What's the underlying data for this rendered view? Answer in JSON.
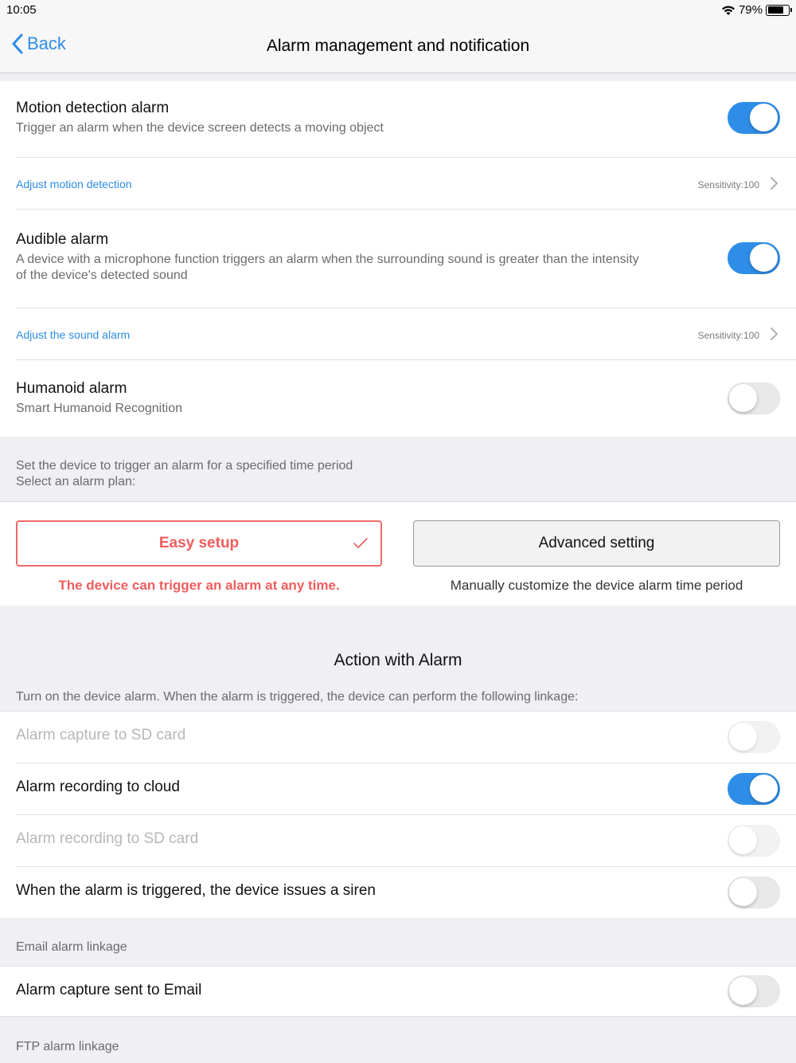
{
  "status": {
    "time": "10:05",
    "battery": "79%"
  },
  "nav": {
    "back_label": "Back",
    "title": "Alarm management and notification"
  },
  "motion": {
    "title": "Motion detection alarm",
    "subtitle": "Trigger an alarm when the device screen detects a moving object",
    "enabled": true,
    "adjust_label": "Adjust motion detection",
    "sensitivity": "Sensitivity:100"
  },
  "audible": {
    "title": "Audible alarm",
    "subtitle_line1": "A device with a microphone function triggers an alarm when the surrounding sound is greater than the intensity",
    "subtitle_line2": "of the device's detected sound",
    "enabled": true,
    "adjust_label": "Adjust the sound alarm",
    "sensitivity": "Sensitivity:100"
  },
  "humanoid": {
    "title": "Humanoid alarm",
    "subtitle": "Smart Humanoid Recognition",
    "enabled": false
  },
  "plan": {
    "hint_line1": "Set the device to trigger an alarm for a specified time period",
    "hint_line2": "Select an alarm plan:",
    "easy_label": "Easy setup",
    "easy_desc": "The device can trigger an alarm at any time.",
    "advanced_label": "Advanced setting",
    "advanced_desc": "Manually customize the device alarm time period",
    "selected": "easy"
  },
  "action": {
    "header": "Action with Alarm",
    "hint": "Turn on the device alarm. When the alarm is triggered, the device can perform the following linkage:",
    "items": [
      {
        "label": "Alarm capture to SD card",
        "enabled": false,
        "disabled": true
      },
      {
        "label": "Alarm recording to cloud",
        "enabled": true,
        "disabled": false
      },
      {
        "label": "Alarm recording to SD card",
        "enabled": false,
        "disabled": true
      },
      {
        "label": "When the alarm is triggered, the device issues a siren",
        "enabled": false,
        "disabled": false
      }
    ]
  },
  "email": {
    "header": "Email alarm linkage",
    "item_label": "Alarm capture sent to Email",
    "enabled": false
  },
  "ftp": {
    "header": "FTP alarm linkage"
  },
  "colors": {
    "accent": "#2e8de6",
    "easy_red": "#ef5d5d",
    "background": "#efeff4"
  }
}
